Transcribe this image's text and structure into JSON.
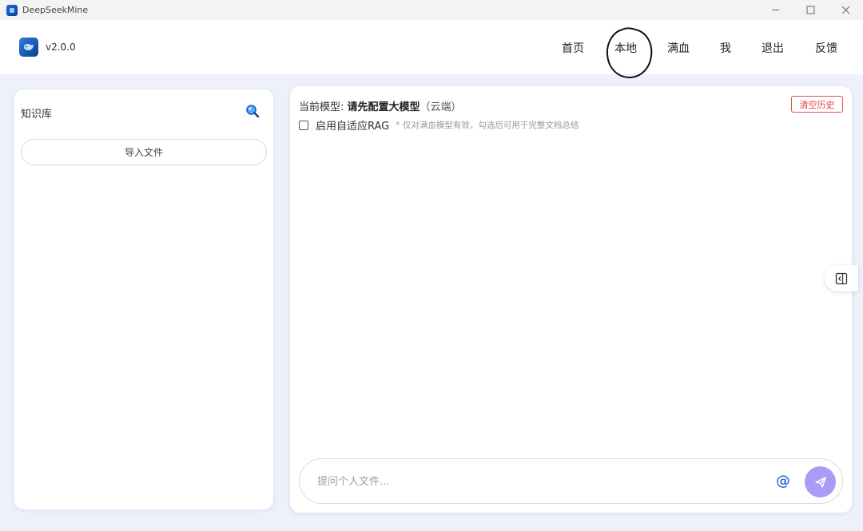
{
  "window": {
    "title": "DeepSeekMine",
    "controls": [
      "minimize-icon",
      "maximize-icon",
      "close-icon"
    ]
  },
  "header": {
    "version": "v2.0.0",
    "nav": [
      {
        "label": "首页"
      },
      {
        "label": "本地",
        "annotated": true
      },
      {
        "label": "满血"
      },
      {
        "label": "我"
      },
      {
        "label": "退出"
      },
      {
        "label": "反馈"
      }
    ]
  },
  "knowledge_base": {
    "title": "知识库",
    "search_icon": "search-icon",
    "import_label": "导入文件"
  },
  "chat": {
    "model_prefix": "当前模型: ",
    "model_name": "请先配置大模型",
    "model_suffix": "（云端）",
    "clear_label": "清空历史",
    "rag_label": "启用自适应RAG",
    "rag_checked": false,
    "rag_hint": "* 仅对满血模型有效，勾选后可用于完整文档总结",
    "input_placeholder": "提问个人文件...",
    "input_value": "",
    "at_label": "@",
    "send_icon": "send-icon"
  },
  "side_toggle_icon": "collapse-panel-icon",
  "colors": {
    "background": "#eef1fb",
    "accent": "#a99cf5",
    "danger": "#e04040",
    "link": "#3a7bd5"
  }
}
